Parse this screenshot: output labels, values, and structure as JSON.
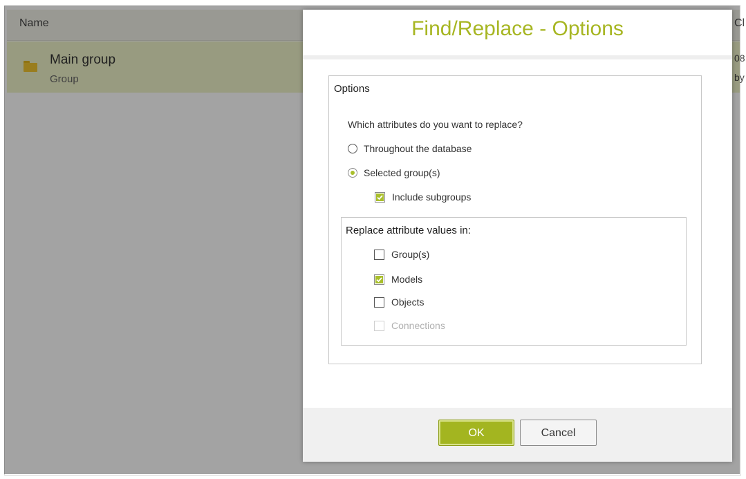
{
  "background": {
    "columns": {
      "name": "Name",
      "changed": "Cl"
    },
    "row": {
      "title": "Main group",
      "type": "Group",
      "changed_date": "08",
      "changed_by": "by"
    }
  },
  "dialog": {
    "title": "Find/Replace - Options",
    "options_legend": "Options",
    "question": "Which attributes do you want to replace?",
    "scope": [
      {
        "label": "Throughout the database",
        "selected": false
      },
      {
        "label": "Selected group(s)",
        "selected": true
      }
    ],
    "include_subgroups": {
      "label": "Include subgroups",
      "checked": true
    },
    "replace_legend": "Replace attribute values in:",
    "targets": [
      {
        "label": "Group(s)",
        "checked": false,
        "enabled": true
      },
      {
        "label": "Models",
        "checked": true,
        "enabled": true
      },
      {
        "label": "Objects",
        "checked": false,
        "enabled": true
      },
      {
        "label": "Connections",
        "checked": false,
        "enabled": false
      }
    ],
    "buttons": {
      "ok": "OK",
      "cancel": "Cancel"
    }
  },
  "colors": {
    "accent": "#a7b623",
    "row_highlight": "#eef2c8"
  }
}
